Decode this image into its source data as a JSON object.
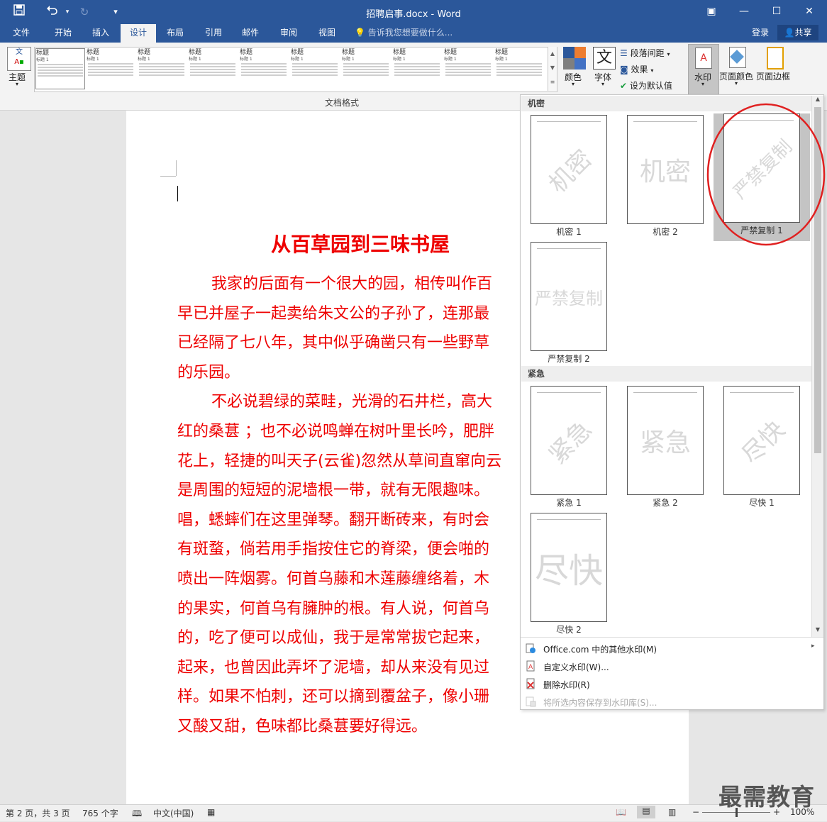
{
  "titlebar": {
    "title": "招聘启事.docx - Word",
    "save_icon": "save-icon",
    "undo_icon": "undo-icon",
    "redo_icon": "redo-icon",
    "customize_icon": "customize-qat-icon"
  },
  "tabs": [
    "文件",
    "开始",
    "插入",
    "设计",
    "布局",
    "引用",
    "邮件",
    "审阅",
    "视图"
  ],
  "active_tab": "设计",
  "tell_me": "告诉我您想要做什么...",
  "account": {
    "login": "登录",
    "share": "共享"
  },
  "ribbon": {
    "theme_label": "主题",
    "group_label": "文档格式",
    "gallery": [
      {
        "title": "标题",
        "sub": "标题 1"
      },
      {
        "title": "标题",
        "sub": "标题 1"
      },
      {
        "title": "标题",
        "sub": "标题 1"
      },
      {
        "title": "标题",
        "sub": "标题 1"
      },
      {
        "title": "标题",
        "sub": "标题 1"
      },
      {
        "title": "标题",
        "sub": "标题 1"
      },
      {
        "title": "标题",
        "sub": "标题 1"
      },
      {
        "title": "标题",
        "sub": "标题 1"
      },
      {
        "title": "标题",
        "sub": "标题 1"
      },
      {
        "title": "标题",
        "sub": "标题 1"
      }
    ],
    "colors_label": "颜色",
    "fonts_label": "字体",
    "paragraph_spacing_label": "段落间距",
    "effects_label": "效果",
    "set_default_label": "设为默认值",
    "watermark_label": "水印",
    "page_color_label": "页面颜色",
    "page_borders_label": "页面边框"
  },
  "document": {
    "title": "从百草园到三味书屋",
    "lines": [
      "我家的后面有一个很大的园，相传叫作百",
      "早已并屋子一起卖给朱文公的子孙了，连那最",
      "已经隔了七八年，其中似乎确凿只有一些野草",
      "的乐园。",
      "不必说碧绿的菜畦，光滑的石井栏，高大",
      "红的桑葚 ；也不必说鸣蝉在树叶里长吟，肥胖",
      "花上，轻捷的叫天子(云雀)忽然从草间直窜向云",
      "是周围的短短的泥墙根一带，就有无限趣味。",
      "唱，蟋蟀们在这里弹琴。翻开断砖来，有时会",
      "有斑蝥，倘若用手指按住它的脊梁，便会啪的",
      "喷出一阵烟雾。何首乌藤和木莲藤缠络着，木",
      "的果实，何首乌有臃肿的根。有人说，何首乌",
      "的，吃了便可以成仙，我于是常常拔它起来，",
      "起来，也曾因此弄坏了泥墙，却从来没有见过",
      "样。如果不怕刺，还可以摘到覆盆子，像小珊",
      "又酸又甜，色味都比桑葚要好得远。"
    ]
  },
  "watermark_menu": {
    "section1": "机密",
    "section2": "紧急",
    "items1": [
      {
        "text": "机密",
        "caption": "机密 1",
        "style": "diagonal"
      },
      {
        "text": "机密",
        "caption": "机密 2",
        "style": "horizontal"
      },
      {
        "text": "严禁复制",
        "caption": "严禁复制 1",
        "style": "diagonal"
      },
      {
        "text": "严禁复制",
        "caption": "严禁复制 2",
        "style": "horizontal"
      }
    ],
    "items2": [
      {
        "text": "紧急",
        "caption": "紧急 1",
        "style": "diagonal"
      },
      {
        "text": "紧急",
        "caption": "紧急 2",
        "style": "horizontal"
      },
      {
        "text": "尽快",
        "caption": "尽快 1",
        "style": "diagonal"
      },
      {
        "text": "尽快",
        "caption": "尽快 2",
        "style": "horizontal"
      }
    ],
    "selected": "严禁复制 1",
    "actions": [
      {
        "label": "Office.com 中的其他水印(M)",
        "enabled": true,
        "has_submenu": true
      },
      {
        "label": "自定义水印(W)...",
        "enabled": true,
        "has_submenu": false
      },
      {
        "label": "删除水印(R)",
        "enabled": true,
        "has_submenu": false
      },
      {
        "label": "将所选内容保存到水印库(S)...",
        "enabled": false,
        "has_submenu": false
      }
    ]
  },
  "statusbar": {
    "page": "第 2 页，共 3 页",
    "words": "765 个字",
    "language": "中文(中国)",
    "zoom": "100%",
    "zoom_level": 1.0
  },
  "brand": "最需教育",
  "colors": {
    "accent": "#2b579a",
    "doc_text": "#ee0000",
    "highlight": "#e02020"
  }
}
